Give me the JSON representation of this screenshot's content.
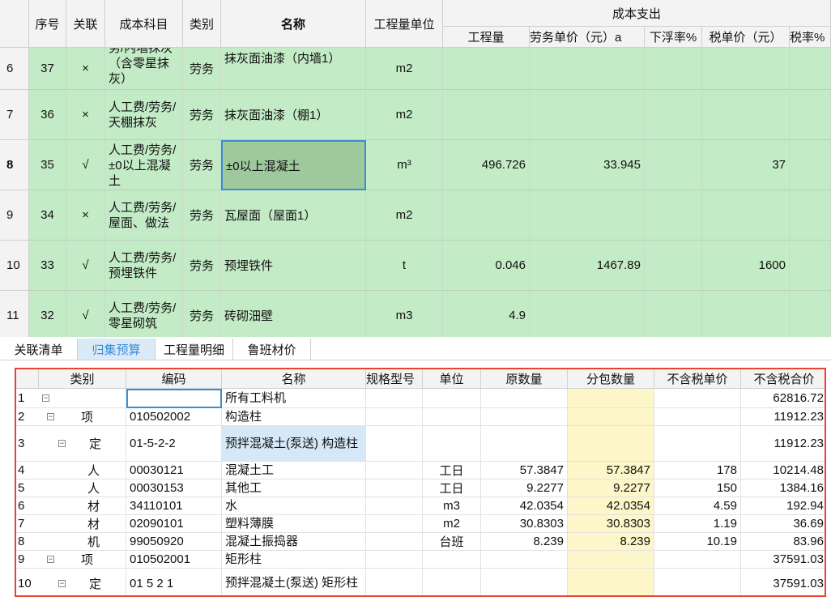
{
  "top_header": {
    "cols": [
      "序号",
      "关联",
      "成本科目",
      "类别",
      "名称",
      "工程量单位"
    ],
    "group": "成本支出",
    "sub": [
      "工程量",
      "劳务单价（元）a",
      "下浮率%",
      "税单价（元）",
      "税率%"
    ]
  },
  "top_rows": [
    {
      "num": "6",
      "seq": "37",
      "rel": "×",
      "subject": "务/内墙抹灰（含零星抹灰）",
      "cat": "劳务",
      "name": "抹灰面油漆（内墙1）",
      "unit": "m2",
      "qty": "",
      "price": "",
      "rate": "",
      "tax": ""
    },
    {
      "num": "7",
      "seq": "36",
      "rel": "×",
      "subject": "人工费/劳务/天棚抹灰",
      "cat": "劳务",
      "name": "抹灰面油漆（棚1）",
      "unit": "m2",
      "qty": "",
      "price": "",
      "rate": "",
      "tax": ""
    },
    {
      "num": "8",
      "seq": "35",
      "rel": "√",
      "subject": "人工费/劳务/±0以上混凝土",
      "cat": "劳务",
      "name": "±0以上混凝土",
      "unit": "m³",
      "qty": "496.726",
      "price": "33.945",
      "rate": "",
      "tax": "37"
    },
    {
      "num": "9",
      "seq": "34",
      "rel": "×",
      "subject": "人工费/劳务/屋面、做法",
      "cat": "劳务",
      "name": "瓦屋面（屋面1）",
      "unit": "m2",
      "qty": "",
      "price": "",
      "rate": "",
      "tax": ""
    },
    {
      "num": "10",
      "seq": "33",
      "rel": "√",
      "subject": "人工费/劳务/预埋铁件",
      "cat": "劳务",
      "name": "预埋铁件",
      "unit": "t",
      "qty": "0.046",
      "price": "1467.89",
      "rate": "",
      "tax": "1600"
    },
    {
      "num": "11",
      "seq": "32",
      "rel": "√",
      "subject": "人工费/劳务/零星砌筑",
      "cat": "劳务",
      "name": "砖砌沺壁",
      "unit": "m3",
      "qty": "4.9",
      "price": "",
      "rate": "",
      "tax": ""
    }
  ],
  "tabs": [
    "关联清单",
    "归集预算",
    "工程量明细",
    "鲁班材价"
  ],
  "bottom_header": [
    "类别",
    "编码",
    "名称",
    "规格型号",
    "单位",
    "原数量",
    "分包数量",
    "不含税单价",
    "不含税合价"
  ],
  "bottom_rows": [
    {
      "num": "1",
      "cat": "",
      "code": "",
      "name": "所有工料机",
      "spec": "",
      "unit": "",
      "orig": "",
      "sub": "",
      "price": "",
      "total": "62816.72"
    },
    {
      "num": "2",
      "cat": "项",
      "code": "010502002",
      "name": "构造柱",
      "spec": "",
      "unit": "",
      "orig": "",
      "sub": "",
      "price": "",
      "total": "11912.23"
    },
    {
      "num": "3",
      "cat": "定",
      "code": "01-5-2-2",
      "name": "预拌混凝土(泵送) 构造柱",
      "spec": "",
      "unit": "",
      "orig": "",
      "sub": "",
      "price": "",
      "total": "11912.23"
    },
    {
      "num": "4",
      "cat": "人",
      "code": "00030121",
      "name": "混凝土工",
      "spec": "",
      "unit": "工日",
      "orig": "57.3847",
      "sub": "57.3847",
      "price": "178",
      "total": "10214.48"
    },
    {
      "num": "5",
      "cat": "人",
      "code": "00030153",
      "name": "其他工",
      "spec": "",
      "unit": "工日",
      "orig": "9.2277",
      "sub": "9.2277",
      "price": "150",
      "total": "1384.16"
    },
    {
      "num": "6",
      "cat": "材",
      "code": "34110101",
      "name": "水",
      "spec": "",
      "unit": "m3",
      "orig": "42.0354",
      "sub": "42.0354",
      "price": "4.59",
      "total": "192.94"
    },
    {
      "num": "7",
      "cat": "材",
      "code": "02090101",
      "name": "塑料薄膜",
      "spec": "",
      "unit": "m2",
      "orig": "30.8303",
      "sub": "30.8303",
      "price": "1.19",
      "total": "36.69"
    },
    {
      "num": "8",
      "cat": "机",
      "code": "99050920",
      "name": "混凝土振捣器",
      "spec": "",
      "unit": "台班",
      "orig": "8.239",
      "sub": "8.239",
      "price": "10.19",
      "total": "83.96"
    },
    {
      "num": "9",
      "cat": "项",
      "code": "010502001",
      "name": "矩形柱",
      "spec": "",
      "unit": "",
      "orig": "",
      "sub": "",
      "price": "",
      "total": "37591.03"
    },
    {
      "num": "10",
      "cat": "定",
      "code": "01 5 2 1",
      "name": "预拌混凝土(泵送) 矩形柱",
      "spec": "",
      "unit": "",
      "orig": "",
      "sub": "",
      "price": "",
      "total": "37591.03"
    }
  ],
  "colors": {
    "green": "#c3ebc6",
    "accent": "#e8432e",
    "selected": "#3a8ed6",
    "yellow": "#fdf6c8"
  }
}
